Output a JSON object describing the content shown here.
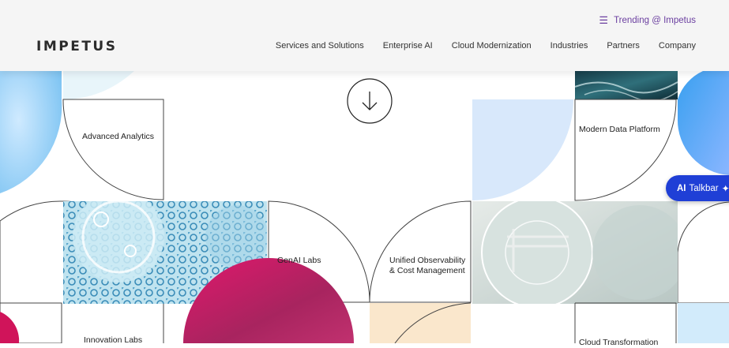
{
  "header": {
    "logo": "IMPETUS",
    "trending": "Trending @ Impetus",
    "nav": [
      "Services and Solutions",
      "Enterprise AI",
      "Cloud Modernization",
      "Industries",
      "Partners",
      "Company"
    ]
  },
  "tiles": {
    "advanced_analytics": "Advanced Analytics",
    "modern_data_platform": "Modern Data Platform",
    "genai_labs": "GenAI Labs",
    "unified_line1": "Unified Observability",
    "unified_line2": "& Cost Management",
    "innovation_labs": "Innovation Labs",
    "cloud_transformation": "Cloud Transformation"
  },
  "talkbar": {
    "ai": "AI",
    "label": "Talkbar"
  },
  "colors": {
    "accent": "#6b3fa0",
    "talkbar": "#1f3fd6",
    "blue_soft": "#a8d8f5",
    "magenta": "#d4145a"
  }
}
